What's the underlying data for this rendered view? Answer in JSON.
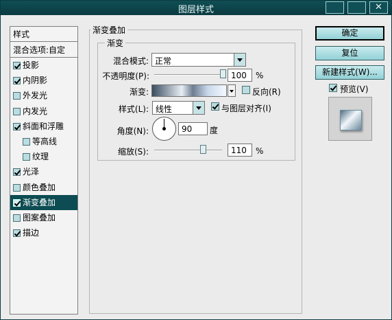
{
  "window": {
    "title": "图层样式"
  },
  "titlebar_buttons": [
    {
      "name": "tb-restore-button",
      "glyph": ""
    },
    {
      "name": "tb-maximize-button",
      "glyph": ""
    },
    {
      "name": "tb-close-button",
      "glyph": "✕"
    }
  ],
  "left": {
    "header": "样式",
    "blend": "混合选项:自定",
    "items": [
      {
        "label": "投影",
        "checked": true
      },
      {
        "label": "内阴影",
        "checked": true
      },
      {
        "label": "外发光",
        "checked": false
      },
      {
        "label": "内发光",
        "checked": false
      },
      {
        "label": "斜面和浮雕",
        "checked": true
      },
      {
        "label": "等高线",
        "checked": false,
        "sub": true
      },
      {
        "label": "纹理",
        "checked": false,
        "sub": true
      },
      {
        "label": "光泽",
        "checked": true
      },
      {
        "label": "颜色叠加",
        "checked": false
      },
      {
        "label": "渐变叠加",
        "checked": true,
        "selected": true
      },
      {
        "label": "图案叠加",
        "checked": false
      },
      {
        "label": "描边",
        "checked": true
      }
    ]
  },
  "main": {
    "group_title": "渐变叠加",
    "inner_title": "渐变",
    "blend_mode_label": "混合模式:",
    "blend_mode_value": "正常",
    "opacity_label": "不透明度(P):",
    "opacity_value": "100",
    "opacity_unit": "%",
    "opacity_level": 100,
    "gradient_label": "渐变:",
    "reverse_label": "反向(R)",
    "reverse_checked": false,
    "style_label": "样式(L):",
    "style_value": "线性",
    "align_label": "与图层对齐(I)",
    "align_checked": true,
    "angle_label": "角度(N):",
    "angle_value": "90",
    "angle_unit": "度",
    "scale_label": "缩放(S):",
    "scale_value": "110",
    "scale_unit": "%",
    "scale_level": 110
  },
  "right": {
    "ok": "确定",
    "reset": "复位",
    "new_style": "新建样式(W)...",
    "preview_label": "预览(V)",
    "preview_checked": true
  },
  "colors": {
    "titlebar": "#0f4f55",
    "selected": "#0c4c52",
    "button": "#a6dde1"
  }
}
